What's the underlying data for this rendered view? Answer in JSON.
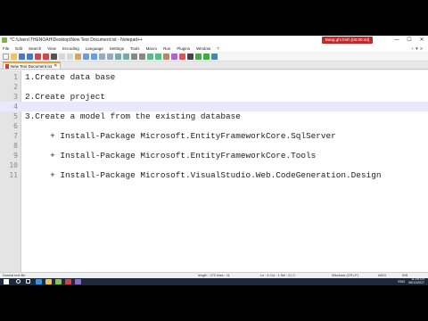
{
  "window": {
    "title": "*C:\\Users\\THENOAH\\Desktop\\New Text Document.txt - Notepad++",
    "recording_badge": "Đang ghi hình [00:00:43]",
    "minimize": "—",
    "maximize": "☐",
    "close": "✕"
  },
  "menu": {
    "items": [
      "File",
      "Edit",
      "Search",
      "View",
      "Encoding",
      "Language",
      "Settings",
      "Tools",
      "Macro",
      "Run",
      "Plugins",
      "Window",
      "?"
    ],
    "right": "+ ▼ X"
  },
  "tabs": [
    {
      "label": "New Text Document.txt",
      "close": "✕"
    }
  ],
  "editor": {
    "lines": [
      {
        "n": "1",
        "text": "1.Create data base"
      },
      {
        "n": "2",
        "text": ""
      },
      {
        "n": "3",
        "text": "2.Create project"
      },
      {
        "n": "4",
        "text": ""
      },
      {
        "n": "5",
        "text": "3.Create a model from the existing database"
      },
      {
        "n": "6",
        "text": ""
      },
      {
        "n": "7",
        "text": "     + Install-Package Microsoft.EntityFrameworkCore.SqlServer"
      },
      {
        "n": "8",
        "text": ""
      },
      {
        "n": "9",
        "text": "     + Install-Package Microsoft.EntityFrameworkCore.Tools"
      },
      {
        "n": "10",
        "text": ""
      },
      {
        "n": "11",
        "text": "     + Install-Package Microsoft.VisualStudio.Web.CodeGeneration.Design"
      }
    ],
    "current_line": 4
  },
  "status": {
    "file_type": "Normal text file",
    "length": "length : 270    lines : 11",
    "position": "Ln : 4    Col : 1    Sel : 0 | 0",
    "eol": "Windows (CR LF)",
    "encoding": "ANSI",
    "mode": "INS"
  },
  "taskbar": {
    "icons": [
      {
        "name": "search-icon",
        "color": "#ffffff"
      },
      {
        "name": "task-view-icon",
        "color": "#ffffff"
      },
      {
        "name": "edge-icon",
        "color": "#3a8ee6"
      },
      {
        "name": "file-explorer-icon",
        "color": "#f2c14e"
      },
      {
        "name": "notepadpp-icon",
        "color": "#8cc152"
      },
      {
        "name": "recorder-icon",
        "color": "#d94040"
      },
      {
        "name": "visual-studio-icon",
        "color": "#8e6cc8"
      }
    ],
    "language": "ENG",
    "time": "11:29 CH",
    "date": "06/11/2017"
  },
  "colors": {
    "current_line": "#e8e8ff",
    "active_tab_marker": "#f0a030",
    "taskbar": "#1c2a3c"
  }
}
